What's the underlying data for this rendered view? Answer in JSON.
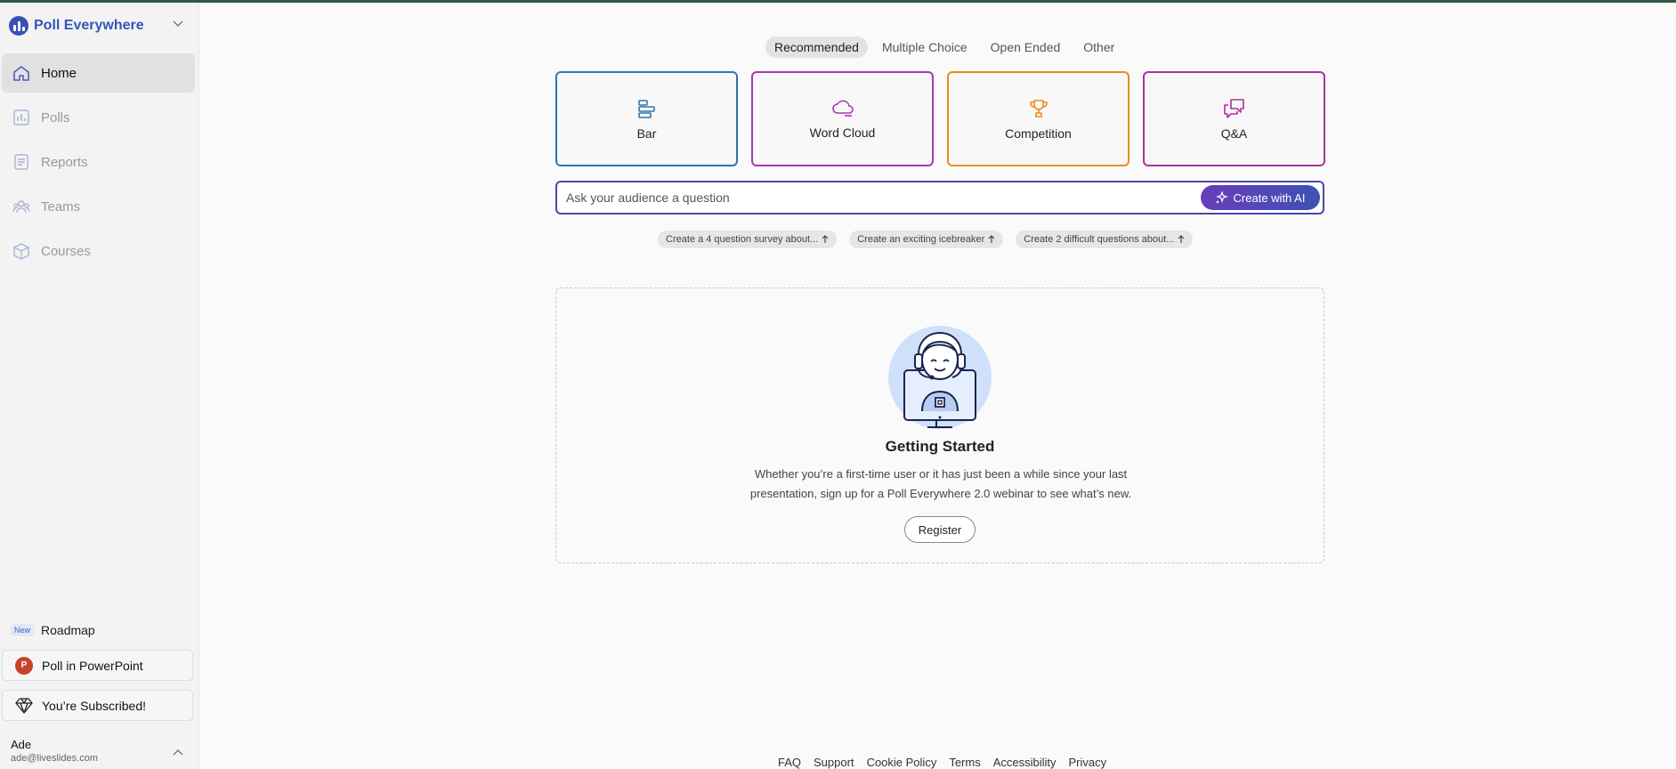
{
  "brand": {
    "name": "Poll Everywhere"
  },
  "sidebar": {
    "items": [
      {
        "label": "Home",
        "icon": "home-icon"
      },
      {
        "label": "Polls",
        "icon": "bar-chart-icon"
      },
      {
        "label": "Reports",
        "icon": "report-icon"
      },
      {
        "label": "Teams",
        "icon": "team-icon"
      },
      {
        "label": "Courses",
        "icon": "courses-icon"
      }
    ],
    "roadmap_badge": "New",
    "roadmap_label": "Roadmap",
    "powerpoint_label": "Poll in PowerPoint",
    "powerpoint_icon_letter": "P",
    "subscribed_label": "You’re Subscribed!"
  },
  "user": {
    "name": "Ade",
    "email": "ade@liveslides.com"
  },
  "tabs": [
    "Recommended",
    "Multiple Choice",
    "Open Ended",
    "Other"
  ],
  "cards": [
    {
      "label": "Bar",
      "color": "#2e77b0"
    },
    {
      "label": "Word Cloud",
      "color": "#a53ab0"
    },
    {
      "label": "Competition",
      "color": "#ec8c1a"
    },
    {
      "label": "Q&A",
      "color": "#b02f9d"
    }
  ],
  "ask": {
    "placeholder": "Ask your audience a question",
    "ai_button": "Create with AI"
  },
  "suggestions": [
    "Create a 4 question survey about...",
    "Create an exciting icebreaker",
    "Create 2 difficult questions about..."
  ],
  "getting_started": {
    "title": "Getting Started",
    "text": "Whether you’re a first-time user or it has just been a while since your last presentation, sign up for a Poll Everywhere 2.0 webinar to see what’s new.",
    "button": "Register"
  },
  "footer": [
    "FAQ",
    "Support",
    "Cookie Policy",
    "Terms",
    "Accessibility",
    "Privacy"
  ]
}
